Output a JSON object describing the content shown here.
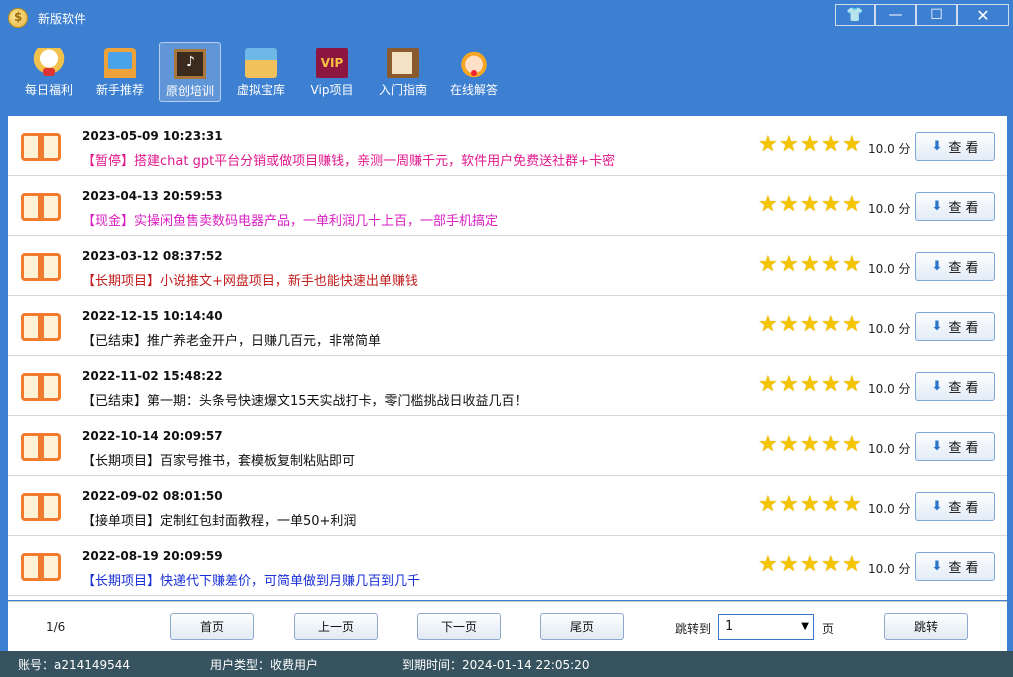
{
  "window": {
    "title": "新版软件",
    "controls": [
      "skin",
      "minimize",
      "maximize",
      "close"
    ]
  },
  "toolbar": {
    "items": [
      {
        "label": "每日福利",
        "icon": "lucky-cat-icon"
      },
      {
        "label": "新手推荐",
        "icon": "computer-icon"
      },
      {
        "label": "原创培训",
        "icon": "chalkboard-icon",
        "active": true
      },
      {
        "label": "虚拟宝库",
        "icon": "treasure-box-icon"
      },
      {
        "label": "Vip项目",
        "icon": "vip-icon",
        "icon_text": "VIP"
      },
      {
        "label": "入门指南",
        "icon": "guide-book-icon"
      },
      {
        "label": "在线解答",
        "icon": "customer-service-icon"
      }
    ]
  },
  "list": {
    "rows": [
      {
        "date": "2023-05-09 10:23:31",
        "title": "【暂停】搭建chat gpt平台分销或做项目赚钱，亲测一周赚千元，软件用户免费送社群+卡密",
        "color": "#e0188c",
        "score": "10.0 分",
        "rating": 5
      },
      {
        "date": "2023-04-13 20:59:53",
        "title": "【现金】实操闲鱼售卖数码电器产品，一单利润几十上百，一部手机搞定",
        "color": "#d81fc0",
        "score": "10.0 分",
        "rating": 5
      },
      {
        "date": "2023-03-12 08:37:52",
        "title": "【长期项目】小说推文+网盘项目，新手也能快速出单赚钱",
        "color": "#c21c1c",
        "score": "10.0 分",
        "rating": 5
      },
      {
        "date": "2022-12-15 10:14:40",
        "title": "【已结束】推广养老金开户，日赚几百元，非常简单",
        "color": "#111111",
        "score": "10.0 分",
        "rating": 5
      },
      {
        "date": "2022-11-02 15:48:22",
        "title": "【已结束】第一期：头条号快速爆文15天实战打卡，零门槛挑战日收益几百！",
        "color": "#111111",
        "score": "10.0 分",
        "rating": 5
      },
      {
        "date": "2022-10-14 20:09:57",
        "title": "【长期项目】百家号推书，套模板复制粘贴即可",
        "color": "#111111",
        "score": "10.0 分",
        "rating": 5
      },
      {
        "date": "2022-09-02 08:01:50",
        "title": "【接单项目】定制红包封面教程，一单50+利润",
        "color": "#111111",
        "score": "10.0 分",
        "rating": 5
      },
      {
        "date": "2022-08-19 20:09:59",
        "title": "【长期项目】快递代下赚差价，可简单做到月赚几百到几千",
        "color": "#1a2fd6",
        "score": "10.0 分",
        "rating": 5
      }
    ],
    "view_label": "查 看",
    "star_char": "★"
  },
  "pager": {
    "page_info": "1/6",
    "first": "首页",
    "prev": "上一页",
    "next": "下一页",
    "last": "尾页",
    "jump_label": "跳转到",
    "jump_value": "1",
    "page_unit": "页",
    "jump_button": "跳转"
  },
  "status": {
    "account": "账号：a214149544",
    "user_type": "用户类型：收费用户",
    "expiry": "到期时间：2024-01-14 22:05:20"
  },
  "colors": {
    "titlebar": "#3d7fd0",
    "status": "#37535f",
    "star": "#f5c400"
  }
}
